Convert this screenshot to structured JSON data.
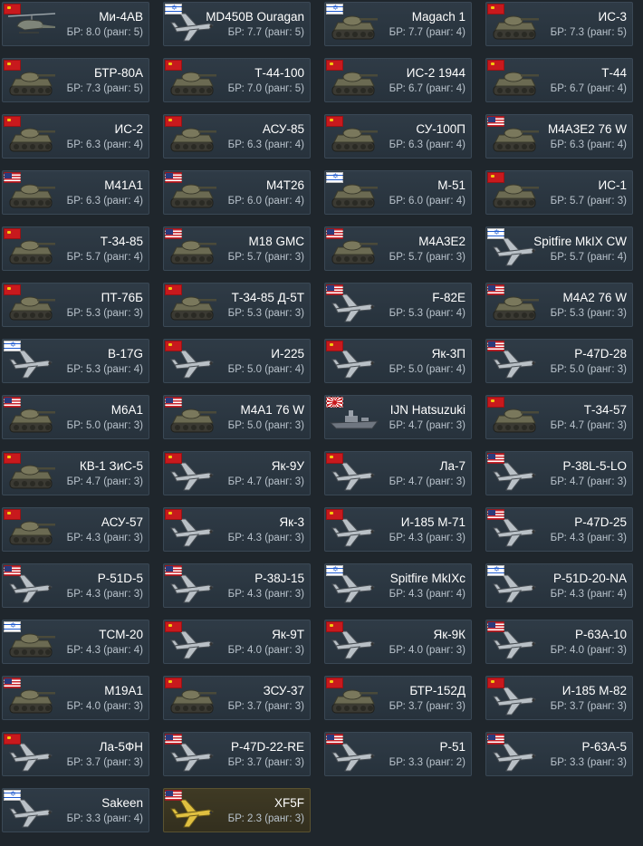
{
  "vehicles": [
    {
      "name": "Ми-4АВ",
      "br": "БР: 8.0 (ранг: 5)",
      "nation": "ussr",
      "kind": "heli"
    },
    {
      "name": "MD450B Ouragan",
      "br": "БР: 7.7 (ранг: 5)",
      "nation": "israel",
      "kind": "plane"
    },
    {
      "name": "Magach 1",
      "br": "БР: 7.7 (ранг: 4)",
      "nation": "israel",
      "kind": "tank"
    },
    {
      "name": "ИС-3",
      "br": "БР: 7.3 (ранг: 5)",
      "nation": "ussr",
      "kind": "tank"
    },
    {
      "name": "БТР-80А",
      "br": "БР: 7.3 (ранг: 5)",
      "nation": "ussr",
      "kind": "tank"
    },
    {
      "name": "Т-44-100",
      "br": "БР: 7.0 (ранг: 5)",
      "nation": "ussr",
      "kind": "tank"
    },
    {
      "name": "ИС-2 1944",
      "br": "БР: 6.7 (ранг: 4)",
      "nation": "ussr",
      "kind": "tank"
    },
    {
      "name": "Т-44",
      "br": "БР: 6.7 (ранг: 4)",
      "nation": "ussr",
      "kind": "tank"
    },
    {
      "name": "ИС-2",
      "br": "БР: 6.3 (ранг: 4)",
      "nation": "ussr",
      "kind": "tank"
    },
    {
      "name": "АСУ-85",
      "br": "БР: 6.3 (ранг: 4)",
      "nation": "ussr",
      "kind": "tank"
    },
    {
      "name": "СУ-100П",
      "br": "БР: 6.3 (ранг: 4)",
      "nation": "ussr",
      "kind": "tank"
    },
    {
      "name": "M4A3E2 76 W",
      "br": "БР: 6.3 (ранг: 4)",
      "nation": "usa",
      "kind": "tank"
    },
    {
      "name": "M41A1",
      "br": "БР: 6.3 (ранг: 4)",
      "nation": "usa",
      "kind": "tank"
    },
    {
      "name": "M4T26",
      "br": "БР: 6.0 (ранг: 4)",
      "nation": "usa",
      "kind": "tank"
    },
    {
      "name": "M-51",
      "br": "БР: 6.0 (ранг: 4)",
      "nation": "israel",
      "kind": "tank"
    },
    {
      "name": "ИС-1",
      "br": "БР: 5.7 (ранг: 3)",
      "nation": "ussr",
      "kind": "tank"
    },
    {
      "name": "Т-34-85",
      "br": "БР: 5.7 (ранг: 4)",
      "nation": "ussr",
      "kind": "tank"
    },
    {
      "name": "M18 GMC",
      "br": "БР: 5.7 (ранг: 3)",
      "nation": "usa",
      "kind": "tank"
    },
    {
      "name": "M4A3E2",
      "br": "БР: 5.7 (ранг: 3)",
      "nation": "usa",
      "kind": "tank"
    },
    {
      "name": "Spitfire MkIX CW",
      "br": "БР: 5.7 (ранг: 4)",
      "nation": "israel",
      "kind": "plane"
    },
    {
      "name": "ПТ-76Б",
      "br": "БР: 5.3 (ранг: 3)",
      "nation": "ussr",
      "kind": "tank"
    },
    {
      "name": "Т-34-85 Д-5Т",
      "br": "БР: 5.3 (ранг: 3)",
      "nation": "ussr",
      "kind": "tank"
    },
    {
      "name": "F-82E",
      "br": "БР: 5.3 (ранг: 4)",
      "nation": "usa",
      "kind": "plane"
    },
    {
      "name": "M4A2 76 W",
      "br": "БР: 5.3 (ранг: 3)",
      "nation": "usa",
      "kind": "tank"
    },
    {
      "name": "B-17G",
      "br": "БР: 5.3 (ранг: 4)",
      "nation": "israel",
      "kind": "plane"
    },
    {
      "name": "И-225",
      "br": "БР: 5.0 (ранг: 4)",
      "nation": "ussr",
      "kind": "plane"
    },
    {
      "name": "Як-3П",
      "br": "БР: 5.0 (ранг: 4)",
      "nation": "ussr",
      "kind": "plane"
    },
    {
      "name": "P-47D-28",
      "br": "БР: 5.0 (ранг: 3)",
      "nation": "usa",
      "kind": "plane"
    },
    {
      "name": "M6A1",
      "br": "БР: 5.0 (ранг: 3)",
      "nation": "usa",
      "kind": "tank"
    },
    {
      "name": "M4A1 76 W",
      "br": "БР: 5.0 (ранг: 3)",
      "nation": "usa",
      "kind": "tank"
    },
    {
      "name": "IJN Hatsuzuki",
      "br": "БР: 4.7 (ранг: 3)",
      "nation": "japan",
      "kind": "ship"
    },
    {
      "name": "Т-34-57",
      "br": "БР: 4.7 (ранг: 3)",
      "nation": "ussr",
      "kind": "tank"
    },
    {
      "name": "КВ-1 ЗиС-5",
      "br": "БР: 4.7 (ранг: 3)",
      "nation": "ussr",
      "kind": "tank"
    },
    {
      "name": "Як-9У",
      "br": "БР: 4.7 (ранг: 3)",
      "nation": "ussr",
      "kind": "plane"
    },
    {
      "name": "Ла-7",
      "br": "БР: 4.7 (ранг: 3)",
      "nation": "ussr",
      "kind": "plane"
    },
    {
      "name": "P-38L-5-LO",
      "br": "БР: 4.7 (ранг: 3)",
      "nation": "usa",
      "kind": "plane"
    },
    {
      "name": "АСУ-57",
      "br": "БР: 4.3 (ранг: 3)",
      "nation": "ussr",
      "kind": "tank"
    },
    {
      "name": "Як-3",
      "br": "БР: 4.3 (ранг: 3)",
      "nation": "ussr",
      "kind": "plane"
    },
    {
      "name": "И-185 М-71",
      "br": "БР: 4.3 (ранг: 3)",
      "nation": "ussr",
      "kind": "plane"
    },
    {
      "name": "P-47D-25",
      "br": "БР: 4.3 (ранг: 3)",
      "nation": "usa",
      "kind": "plane"
    },
    {
      "name": "P-51D-5",
      "br": "БР: 4.3 (ранг: 3)",
      "nation": "usa",
      "kind": "plane"
    },
    {
      "name": "P-38J-15",
      "br": "БР: 4.3 (ранг: 3)",
      "nation": "usa",
      "kind": "plane"
    },
    {
      "name": "Spitfire MkIXc",
      "br": "БР: 4.3 (ранг: 4)",
      "nation": "israel",
      "kind": "plane"
    },
    {
      "name": "P-51D-20-NA",
      "br": "БР: 4.3 (ранг: 4)",
      "nation": "israel",
      "kind": "plane"
    },
    {
      "name": "TCM-20",
      "br": "БР: 4.3 (ранг: 4)",
      "nation": "israel",
      "kind": "tank"
    },
    {
      "name": "Як-9Т",
      "br": "БР: 4.0 (ранг: 3)",
      "nation": "ussr",
      "kind": "plane"
    },
    {
      "name": "Як-9К",
      "br": "БР: 4.0 (ранг: 3)",
      "nation": "ussr",
      "kind": "plane"
    },
    {
      "name": "P-63A-10",
      "br": "БР: 4.0 (ранг: 3)",
      "nation": "usa",
      "kind": "plane"
    },
    {
      "name": "M19A1",
      "br": "БР: 4.0 (ранг: 3)",
      "nation": "usa",
      "kind": "tank"
    },
    {
      "name": "ЗСУ-37",
      "br": "БР: 3.7 (ранг: 3)",
      "nation": "ussr",
      "kind": "tank"
    },
    {
      "name": "БТР-152Д",
      "br": "БР: 3.7 (ранг: 3)",
      "nation": "ussr",
      "kind": "tank"
    },
    {
      "name": "И-185 М-82",
      "br": "БР: 3.7 (ранг: 3)",
      "nation": "ussr",
      "kind": "plane"
    },
    {
      "name": "Ла-5ФН",
      "br": "БР: 3.7 (ранг: 3)",
      "nation": "ussr",
      "kind": "plane"
    },
    {
      "name": "P-47D-22-RE",
      "br": "БР: 3.7 (ранг: 3)",
      "nation": "usa",
      "kind": "plane"
    },
    {
      "name": "P-51",
      "br": "БР: 3.3 (ранг: 2)",
      "nation": "usa",
      "kind": "plane"
    },
    {
      "name": "P-63A-5",
      "br": "БР: 3.3 (ранг: 3)",
      "nation": "usa",
      "kind": "plane"
    },
    {
      "name": "Sakeen",
      "br": "БР: 3.3 (ранг: 4)",
      "nation": "israel",
      "kind": "plane"
    },
    {
      "name": "XF5F",
      "br": "БР: 2.3 (ранг: 3)",
      "nation": "usa",
      "kind": "plane",
      "premium": true
    }
  ],
  "colors": {
    "background": "#1f262c",
    "card": "#2f3b46",
    "premium_card": "#3f3a24",
    "name_text": "#ffffff",
    "br_text": "#b9c3cc"
  }
}
